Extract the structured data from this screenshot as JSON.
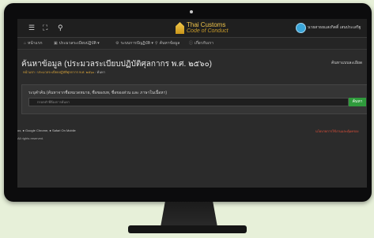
{
  "topbar": {
    "menu_icon": "hamburger-icon",
    "expand_icon": "expand-icon",
    "search_icon": "search-icon",
    "logo_title": "Thai Customs",
    "logo_subtitle": "Code of Conduct",
    "user_name": "นายสาธยแสงกิตติ์ เสนประเสริฐ"
  },
  "nav": {
    "items": [
      {
        "icon": "home-icon",
        "label": "หน้าแรก"
      },
      {
        "icon": "book-icon",
        "label": "ประมวลระเบียบปฏิบัติ ▾"
      },
      {
        "icon": "gear-icon",
        "label": "ระบบการปัญฏิบัติ ▾"
      },
      {
        "icon": "search-icon",
        "label": "ค้นหาข้อมูล"
      },
      {
        "icon": "info-icon",
        "label": "เกี่ยวกับเรา"
      }
    ]
  },
  "page": {
    "title": "ค้นหาข้อมูล (ประมวลระเบียบปฏิบัติศุลกากร พ.ศ. ๒๕๖๐)",
    "right_link": "ค้นหาแบบละเอียด",
    "breadcrumb": {
      "home": "หน้าแรก",
      "sep": "/",
      "middle": "ประมวลระเบียบปฏิบัติศุลกากร พ.ศ. ๒๕๖๐",
      "current": "ค้นหา"
    }
  },
  "search": {
    "label": "ระบุคำค้น (ค้นหาจากชื่อหมวดหมาย, ชื่อของบท, ชื่อของส่วน และ ภาษาในเนื้อหา)",
    "placeholder": "กรอกคำที่ต้องการค้นหา",
    "button_label": "ค้นหา"
  },
  "footer": {
    "browsers_text": "ox, ● Google Chrome, ● Safari On Mobile",
    "copyright": "All rights reserved.",
    "right_text": "นโยบายการใช้งานและคุ้มครอง"
  }
}
